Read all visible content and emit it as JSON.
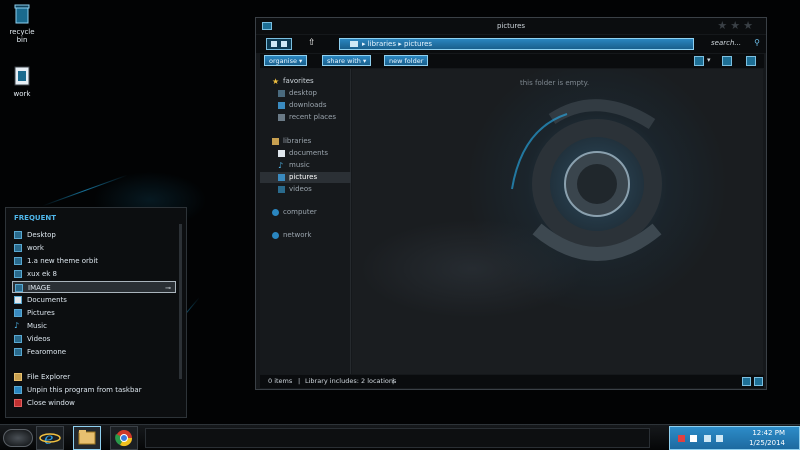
{
  "desktop": {
    "icons": [
      {
        "label_lines": [
          "recycle",
          "bin"
        ],
        "icon": "recycle-bin-icon"
      },
      {
        "label_lines": [
          "work"
        ],
        "icon": "folder-icon"
      }
    ]
  },
  "window": {
    "title": "pictures",
    "address": "▸ libraries ▸ pictures",
    "search_placeholder": "search...",
    "commands": {
      "organize": "organise ▾",
      "share": "share with ▾",
      "new_folder": "new folder"
    },
    "nav": {
      "favorites": "favorites",
      "desktop": "desktop",
      "downloads": "downloads",
      "recent": "recent places",
      "libraries": "libraries",
      "documents": "documents",
      "music": "music",
      "pictures": "pictures",
      "videos": "videos",
      "computer": "computer",
      "network": "network"
    },
    "empty_message": "this folder is empty.",
    "status": {
      "items": "0 items",
      "library": "Library includes: 2 locations"
    }
  },
  "jumplist": {
    "header": "FREQUENT",
    "items": [
      "Desktop",
      "work",
      "1.a new theme orbit",
      "xux ek 8",
      "IMAGE",
      "Documents",
      "Pictures",
      "Music",
      "Videos",
      "Fearomone"
    ],
    "highlighted_index": 4,
    "actions": [
      "File Explorer",
      "Unpin this program from taskbar",
      "Close window"
    ]
  },
  "taskbar": {
    "apps": [
      "internet-explorer",
      "file-explorer",
      "chrome"
    ],
    "time": "12:42 PM",
    "date": "1/25/2014"
  },
  "colors": {
    "accent": "#2a86c0",
    "accent_light": "#8fd0f0",
    "background": "#020304"
  }
}
